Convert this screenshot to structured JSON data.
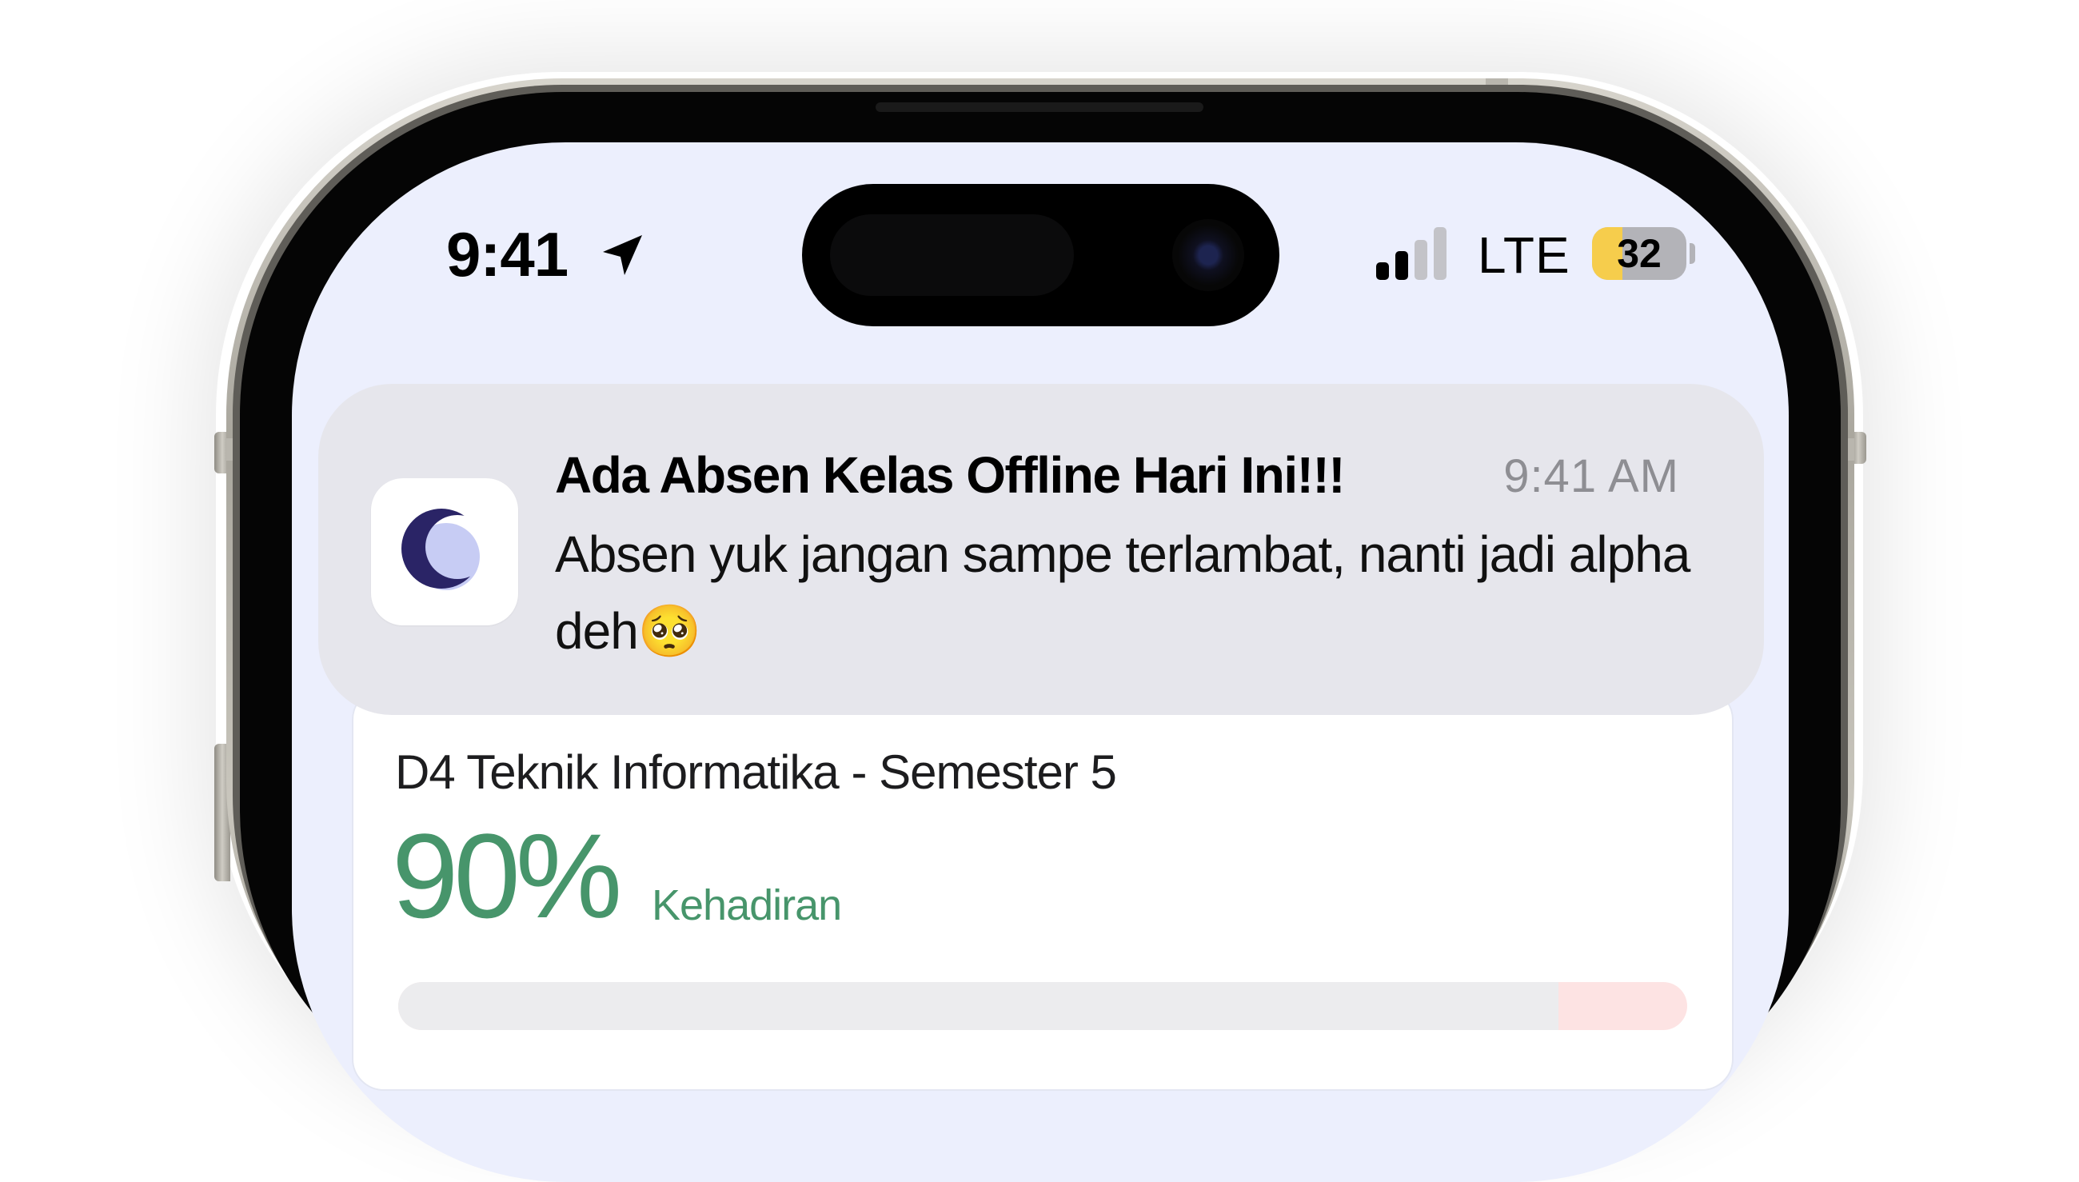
{
  "status_bar": {
    "time": "9:41",
    "location_icon": "location-arrow-icon",
    "signal_icon": "cellular-signal-icon",
    "signal_bars_active": 2,
    "signal_bars_total": 4,
    "network": "LTE",
    "battery_level": "32",
    "battery_fraction": 0.32,
    "battery_color": "#f6cd4c"
  },
  "notification": {
    "app_icon": "app-logo-icon",
    "title": "Ada Absen Kelas Offline Hari Ini!!!",
    "time": "9:41 AM",
    "body": "Absen yuk jangan sampe terlambat, nanti jadi alpha deh🥺"
  },
  "attendance_card": {
    "class_name": "D4 Teknik Informatika - Semester 5",
    "percentage": "90%",
    "percentage_label": "Kehadiran",
    "percentage_value": 0.9,
    "accent_color": "#47956b"
  }
}
